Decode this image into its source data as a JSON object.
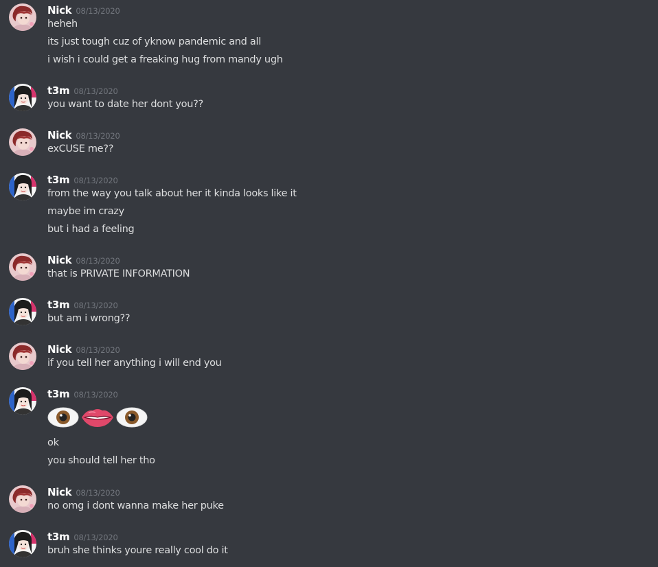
{
  "users": {
    "nick": "Nick",
    "t3m": "t3m"
  },
  "messages": [
    {
      "author": "Nick",
      "timestamp": "08/13/2020",
      "lines": [
        "heheh",
        "its just tough cuz of yknow pandemic and all",
        "i wish i could get a freaking hug from mandy ugh"
      ]
    },
    {
      "author": "t3m",
      "timestamp": "08/13/2020",
      "lines": [
        "you want to date her dont you??"
      ]
    },
    {
      "author": "Nick",
      "timestamp": "08/13/2020",
      "lines": [
        "exCUSE me??"
      ]
    },
    {
      "author": "t3m",
      "timestamp": "08/13/2020",
      "lines": [
        "from the way you talk about her it kinda looks like it",
        "maybe im crazy",
        "but i had a feeling"
      ]
    },
    {
      "author": "Nick",
      "timestamp": "08/13/2020",
      "lines": [
        "that is PRIVATE INFORMATION"
      ]
    },
    {
      "author": "t3m",
      "timestamp": "08/13/2020",
      "lines": [
        "but am i wrong??"
      ]
    },
    {
      "author": "Nick",
      "timestamp": "08/13/2020",
      "lines": [
        "if you tell her anything i will end you"
      ]
    },
    {
      "author": "t3m",
      "timestamp": "08/13/2020",
      "emoji": [
        "eye-emoji",
        "lips-emoji",
        "eye-emoji"
      ],
      "lines": [
        "ok",
        "you should tell her tho"
      ]
    },
    {
      "author": "Nick",
      "timestamp": "08/13/2020",
      "lines": [
        "no omg i dont wanna make her puke"
      ]
    },
    {
      "author": "t3m",
      "timestamp": "08/13/2020",
      "lines": [
        "bruh she thinks youre really cool do it"
      ]
    }
  ],
  "colors": {
    "background": "#36393f",
    "username": "#ffffff",
    "timestamp": "#72767d",
    "text": "#dcddde"
  }
}
